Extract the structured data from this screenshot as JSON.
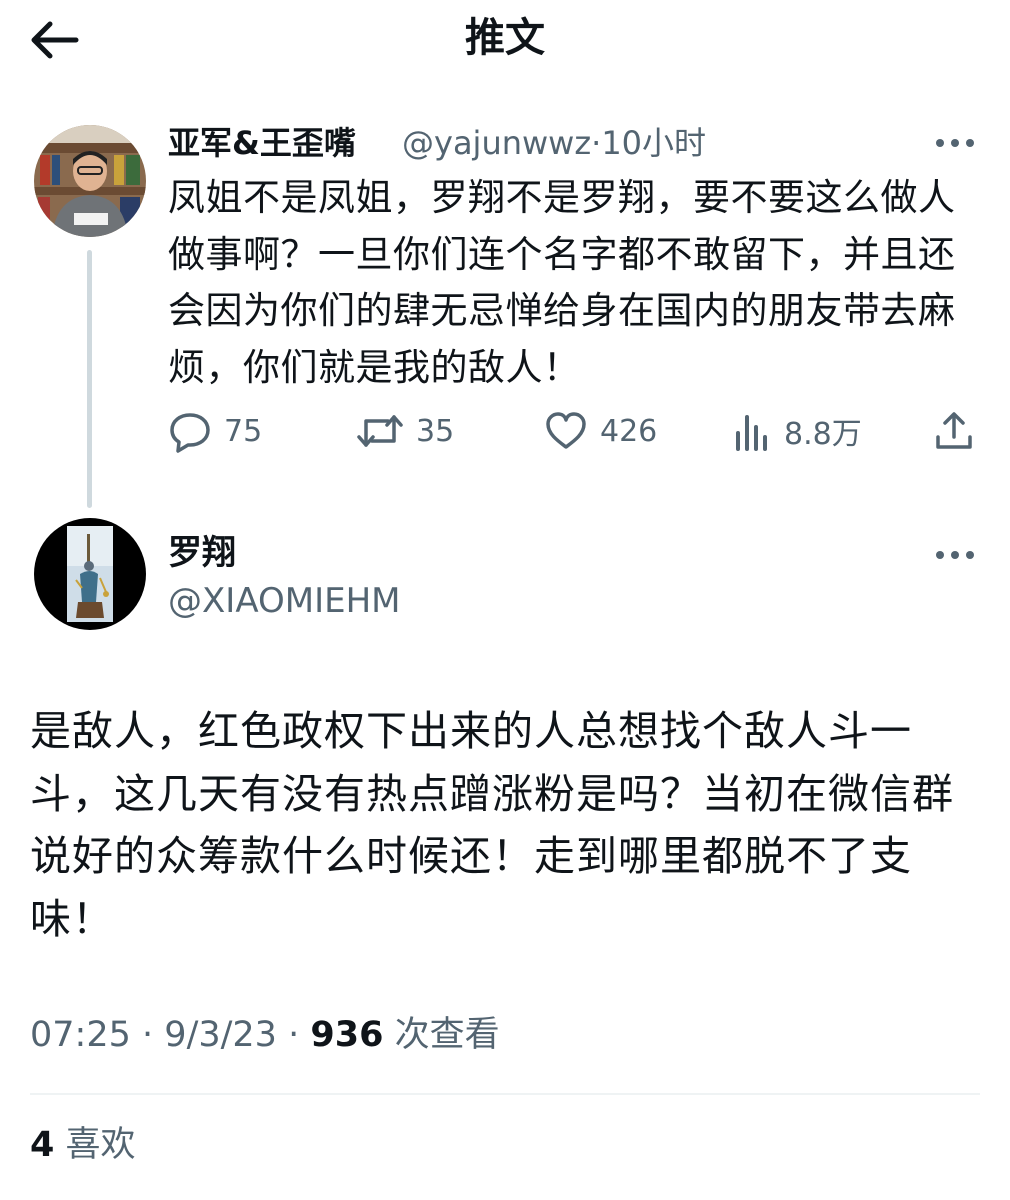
{
  "header": {
    "title": "推文"
  },
  "reply_to_tweet": {
    "author_name": "亚军&王歪嘴",
    "author_handle": "@yajunwwz",
    "separator": "·",
    "time": "10小时",
    "text": "凤姐不是凤姐，罗翔不是罗翔，要不要这么做人做事啊？一旦你们连个名字都不敢留下，并且还会因为你们的肆无忌惮给身在国内的朋友带去麻烦，你们就是我的敌人！",
    "stats": {
      "replies": "75",
      "retweets": "35",
      "likes": "426",
      "views": "8.8万"
    }
  },
  "main_tweet": {
    "author_name": "罗翔",
    "author_handle": "@XIAOMIEHM",
    "text": "是敌人，红色政权下出来的人总想找个敌人斗一斗，这几天有没有热点蹭涨粉是吗？当初在微信群说好的众筹款什么时候还！走到哪里都脱不了支味！",
    "time": "07:25",
    "sep1": "·",
    "date": "9/3/23",
    "sep2": "·",
    "views_count": "936",
    "views_label": "次查看",
    "likes_count": "4",
    "likes_label": "喜欢"
  },
  "icons": [
    "back-arrow-icon",
    "more-icon",
    "reply-icon",
    "retweet-icon",
    "heart-icon",
    "views-icon",
    "share-icon"
  ],
  "colors": {
    "text": "#0f1419",
    "secondary": "#536471",
    "divider": "#eff3f4",
    "thread_line": "#cfd9de"
  }
}
